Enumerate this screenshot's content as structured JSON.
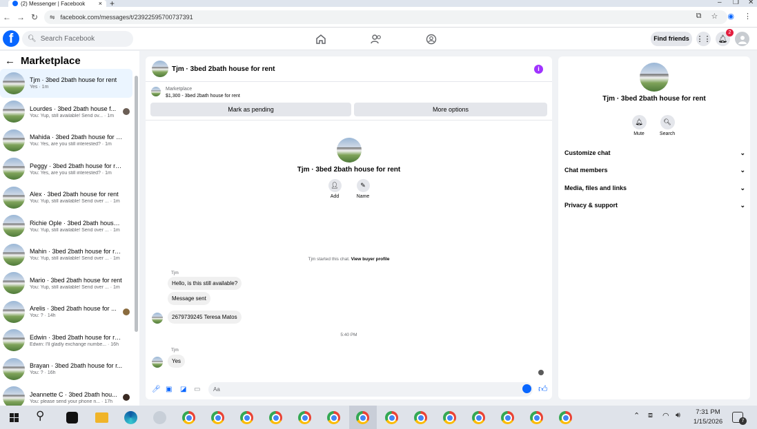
{
  "browser": {
    "tab_title": "(2) Messenger | Facebook",
    "tab_close": "×",
    "new_tab": "+",
    "url": "facebook.com/messages/t/23922595700737391"
  },
  "fbnav": {
    "search_placeholder": "Search Facebook",
    "find_friends": "Find friends",
    "notification_count": "2"
  },
  "sidebar": {
    "back": "←",
    "title": "Marketplace",
    "conversations": [
      {
        "title": "Tjm · 3bed 2bath house for rent",
        "sub": "Yes · 1m"
      },
      {
        "title": "Lourdes · 3bed 2bath house f...",
        "sub": "You: Yup, still available! Send ov... · 1m"
      },
      {
        "title": "Mahida · 3bed 2bath house for r...",
        "sub": "You: Yes, are you still interested? · 1m"
      },
      {
        "title": "Peggy · 3bed 2bath house for rent",
        "sub": "You: Yes, are you still interested? · 1m"
      },
      {
        "title": "Alex · 3bed 2bath house for rent",
        "sub": "You: Yup, still available! Send over ... · 1m"
      },
      {
        "title": "Richie Ople · 3bed 2bath house ...",
        "sub": "You: Yup, still available! Send over ... · 1m"
      },
      {
        "title": "Mahin · 3bed 2bath house for re...",
        "sub": "You: Yup, still available! Send over ... · 1m"
      },
      {
        "title": "Mario · 3bed 2bath house for rent",
        "sub": "You: Yup, still available! Send over ... · 1m"
      },
      {
        "title": "Arelis · 3bed 2bath house for ...",
        "sub": "You: ? · 14h"
      },
      {
        "title": "Edwin · 3bed 2bath house for rent",
        "sub": "Edwin: I'll gladly exchange numbe... · 16h"
      },
      {
        "title": "Brayan · 3bed 2bath house for r...",
        "sub": "You: ? · 16h"
      },
      {
        "title": "Jeannette C · 3bed 2bath hou...",
        "sub": "You: please send your phone n... · 17h"
      }
    ]
  },
  "chat": {
    "title": "Tjm · 3bed 2bath house for rent",
    "info": "i",
    "marketplace_label": "Marketplace",
    "listing": "$1,300 - 3bed 2bath house for rent",
    "mark_pending": "Mark as pending",
    "more_options": "More options",
    "intro_title": "Tjm · 3bed 2bath house for rent",
    "add_label": "Add",
    "name_label": "Name",
    "started_text": "Tjm started this chat.",
    "view_profile": "View buyer profile",
    "sender1": "Tjm",
    "msg1": "Hello, is this still available?",
    "msg2": "Message sent",
    "msg3": "2679739245 Teresa Matos",
    "timestamp": "5:40 PM",
    "sender2": "Tjm",
    "msg4": "Yes",
    "composer_placeholder": "Aa"
  },
  "right": {
    "title": "Tjm · 3bed 2bath house for rent",
    "mute": "Mute",
    "search": "Search",
    "sections": [
      "Customize chat",
      "Chat members",
      "Media, files and links",
      "Privacy & support"
    ]
  },
  "taskbar": {
    "time": "7:31 PM",
    "date": "1/15/2026",
    "notification_count": "7"
  },
  "colors": {
    "fb_blue": "#0866ff",
    "info_purple": "#a033ff",
    "badge_red": "#e41e3f"
  }
}
